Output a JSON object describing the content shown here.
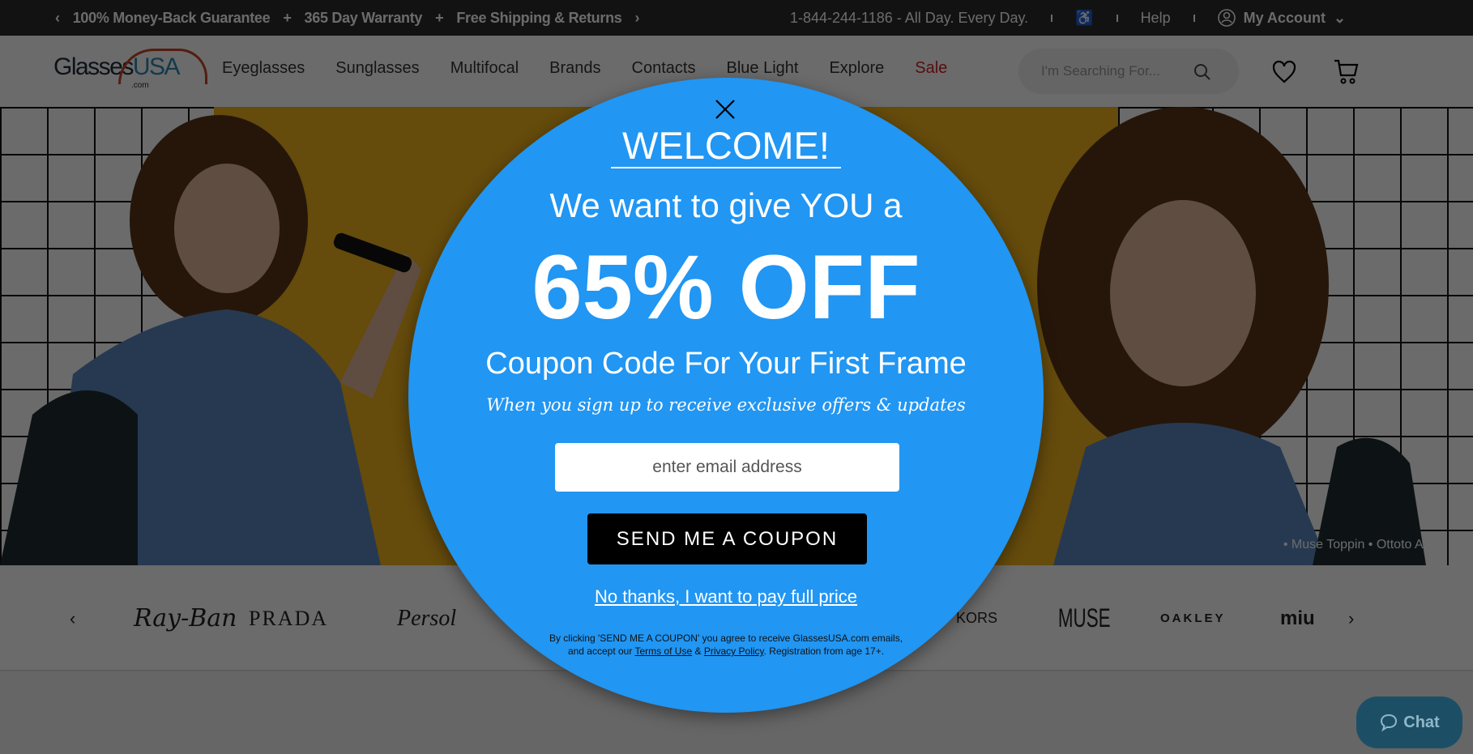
{
  "topbar": {
    "promos": [
      "100% Money-Back Guarantee",
      "+",
      "365 Day Warranty",
      "+",
      "Free Shipping & Returns"
    ],
    "phone": "1-844-244-1186 - All Day. Every Day.",
    "help": "Help",
    "account": "My Account"
  },
  "nav": {
    "logo": {
      "glasses": "Glasses",
      "usa": "USA",
      "com": ".com"
    },
    "items": [
      "Eyeglasses",
      "Sunglasses",
      "Multifocal",
      "Brands",
      "Contacts",
      "Blue Light",
      "Explore",
      "Sale"
    ],
    "search_placeholder": "I'm Searching For..."
  },
  "hero": {
    "credit": "• Muse Toppin • Ottoto Alceo",
    "yellow": "#f1b21c"
  },
  "brands": [
    "Ray-Ban",
    "PRADA",
    "Persol",
    "KORS",
    "MUSE",
    "OAKLEY",
    "miu"
  ],
  "popup": {
    "welcome": "WELCOME!",
    "line1": "We want to give YOU a",
    "discount": "65% OFF",
    "line2": "Coupon Code For Your First Frame",
    "line3": "When you sign up to receive exclusive offers & updates",
    "email_placeholder": "enter email address",
    "button": "SEND ME A COUPON",
    "decline": "No thanks, I want to pay full price",
    "fine1": "By clicking 'SEND ME A COUPON' you agree to receive GlassesUSA.com emails,",
    "fine2a": "and accept our",
    "terms": "Terms of Use",
    "amp": "&",
    "privacy": "Privacy Policy",
    "fine2b": ". Registration from age 17+.",
    "color": "#2196f3"
  },
  "chat": {
    "label": "Chat"
  }
}
